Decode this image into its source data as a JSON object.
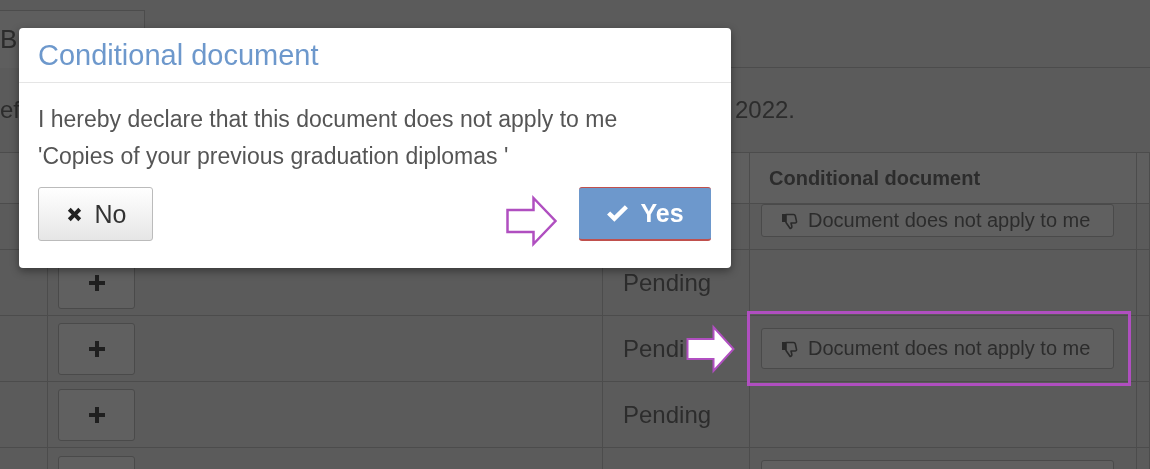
{
  "page": {
    "tab": "B",
    "intro_start": "ef",
    "intro_end": "2022."
  },
  "table": {
    "header": "Conditional document",
    "rows": [
      {
        "kind": "row",
        "document": "Document does not apply to me"
      },
      {
        "kind": "row",
        "add_button": true,
        "status": "Pending"
      },
      {
        "kind": "row",
        "add_button": true,
        "status": "Pendi",
        "document": "Document does not apply to me"
      },
      {
        "kind": "row",
        "add_button": true,
        "status": "Pending"
      },
      {
        "kind": "cut"
      }
    ]
  },
  "dialog": {
    "title": "Conditional document",
    "message_lines": [
      "I hereby declare that this document does not apply to me",
      "'Copies of your previous graduation diplomas '"
    ],
    "buttons": [
      {
        "kind": "cancel",
        "label": "No"
      },
      {
        "kind": "confirm",
        "label": "Yes"
      }
    ]
  },
  "annotations": [
    {
      "kind": "outline-arrow"
    },
    {
      "kind": "solid-arrow"
    },
    {
      "kind": "highlight-box"
    }
  ]
}
